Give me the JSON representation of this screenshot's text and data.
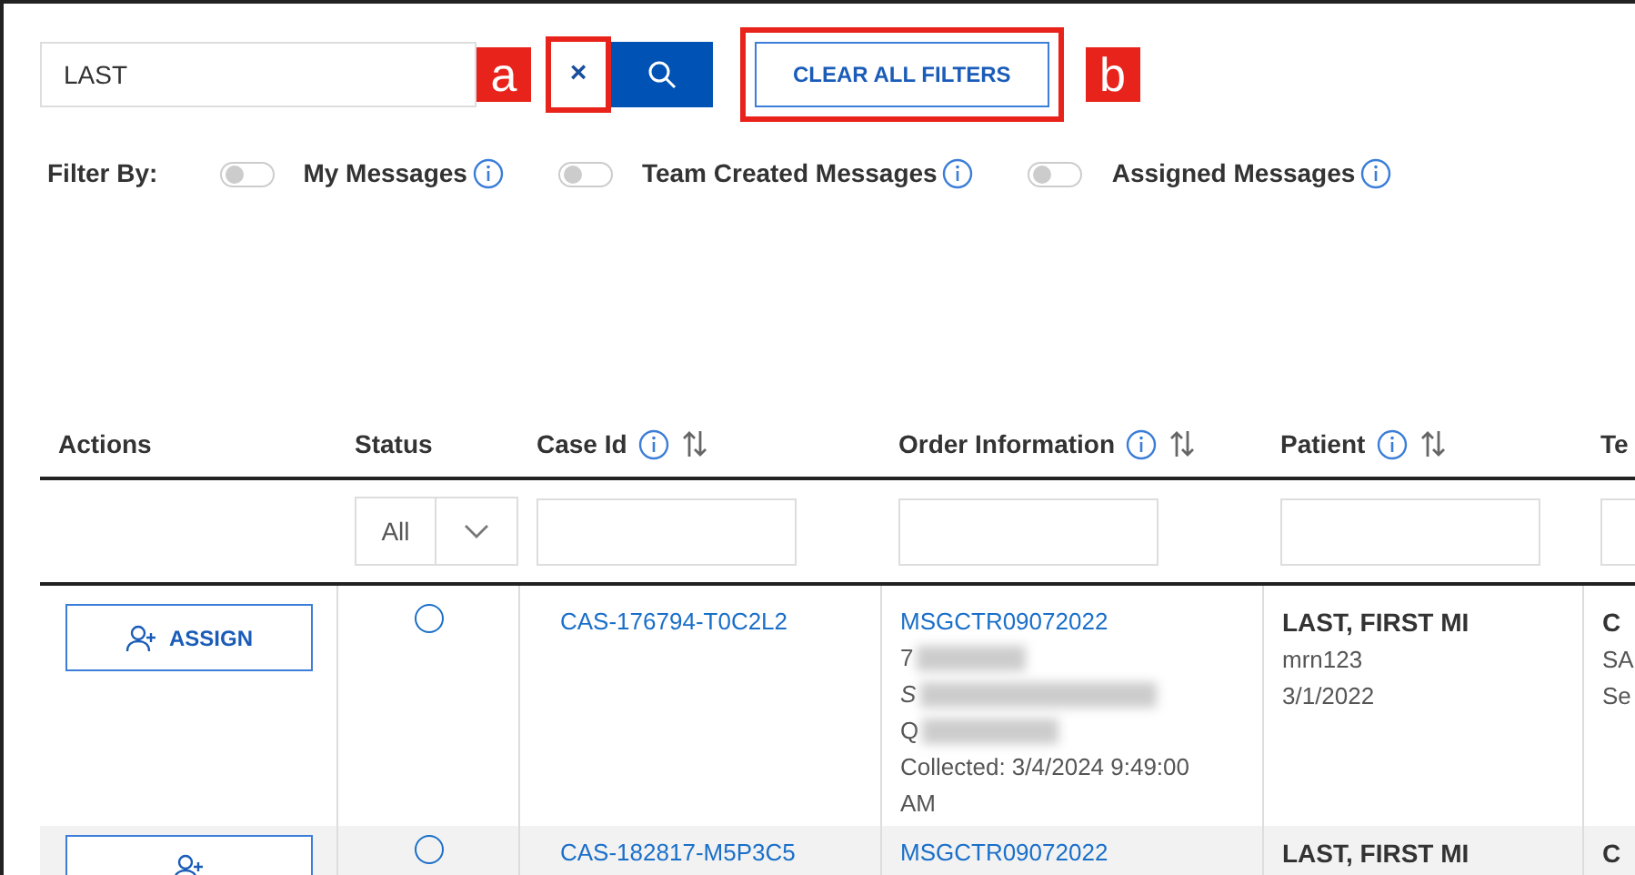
{
  "search": {
    "value": "LAST"
  },
  "annotations": [
    {
      "label": "a"
    },
    {
      "label": "b"
    }
  ],
  "clear_button": {
    "label": "×"
  },
  "clear_all_button": {
    "label": "CLEAR ALL FILTERS"
  },
  "filter_by": {
    "label": "Filter By:",
    "toggles": [
      {
        "label": "My Messages",
        "on": false
      },
      {
        "label": "Team Created Messages",
        "on": false
      },
      {
        "label": "Assigned Messages",
        "on": false
      }
    ]
  },
  "table": {
    "columns": [
      {
        "label": "Actions",
        "info": false,
        "sortable": false
      },
      {
        "label": "Status",
        "info": false,
        "sortable": false,
        "filter": {
          "kind": "select",
          "value": "All"
        }
      },
      {
        "label": "Case Id",
        "info": true,
        "sortable": true,
        "filter": {
          "kind": "text"
        }
      },
      {
        "label": "Order Information",
        "info": true,
        "sortable": true,
        "filter": {
          "kind": "text"
        }
      },
      {
        "label": "Patient",
        "info": true,
        "sortable": true,
        "filter": {
          "kind": "text"
        }
      },
      {
        "label": "Te",
        "info": false,
        "sortable": false,
        "filter": {
          "kind": "text"
        }
      }
    ],
    "rows": [
      {
        "action": "ASSIGN",
        "selected": false,
        "case_id": "CAS-176794-T0C2L2",
        "order": {
          "number": "MSGCTR09072022",
          "lines": [
            {
              "text": "7",
              "italic": false
            },
            {
              "text": "S",
              "italic": true
            },
            {
              "text": "Q",
              "italic": false
            }
          ],
          "collected": "Collected: 3/4/2024 9:49:00 AM"
        },
        "patient": {
          "name": "LAST, FIRST MI",
          "details": [
            "mrn123",
            "3/1/2022"
          ]
        },
        "column_6": [
          "C",
          "SA",
          "Se"
        ]
      },
      {
        "selected": false,
        "case_id": "CAS-182817-M5P3C5",
        "order": {
          "number": "MSGCTR09072022"
        },
        "patient": {
          "name": "LAST, FIRST MI"
        },
        "column_6": [
          "C"
        ]
      }
    ]
  }
}
